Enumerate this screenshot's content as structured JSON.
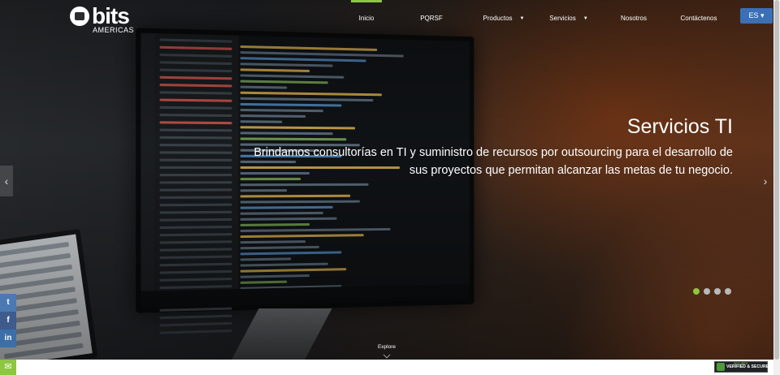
{
  "brand": {
    "name": "bits",
    "subtitle": "AMERICAS"
  },
  "nav": {
    "items": [
      {
        "label": "Inicio",
        "active": true,
        "dropdown": false
      },
      {
        "label": "PQRSF",
        "active": false,
        "dropdown": false
      },
      {
        "label": "Productos",
        "active": false,
        "dropdown": true
      },
      {
        "label": "Servicios",
        "active": false,
        "dropdown": true
      },
      {
        "label": "Nosotros",
        "active": false,
        "dropdown": false
      },
      {
        "label": "Contáctenos",
        "active": false,
        "dropdown": false
      }
    ],
    "caret": "▼"
  },
  "language": {
    "label": "ES ▾"
  },
  "slider": {
    "title": "Servicios TI",
    "text": "Brindamos consultorías en TI y suministro de recursos por outsourcing para el desarrollo de sus proyectos que permitan alcanzar las metas de tu negocio.",
    "prev_icon": "‹",
    "next_icon": "›",
    "total_slides": 4,
    "active_slide": 1
  },
  "explore": {
    "label": "Explore"
  },
  "social": {
    "twitter": "t",
    "facebook": "f",
    "linkedin": "in"
  },
  "contact": {
    "mail_icon": "✉"
  },
  "security_badge": {
    "top": "SECURED",
    "label": "VERIFIED & SECURED"
  },
  "colors": {
    "accent": "#8dc63f",
    "lang_button": "#3b6fb6",
    "social": "#3f5b8c"
  }
}
